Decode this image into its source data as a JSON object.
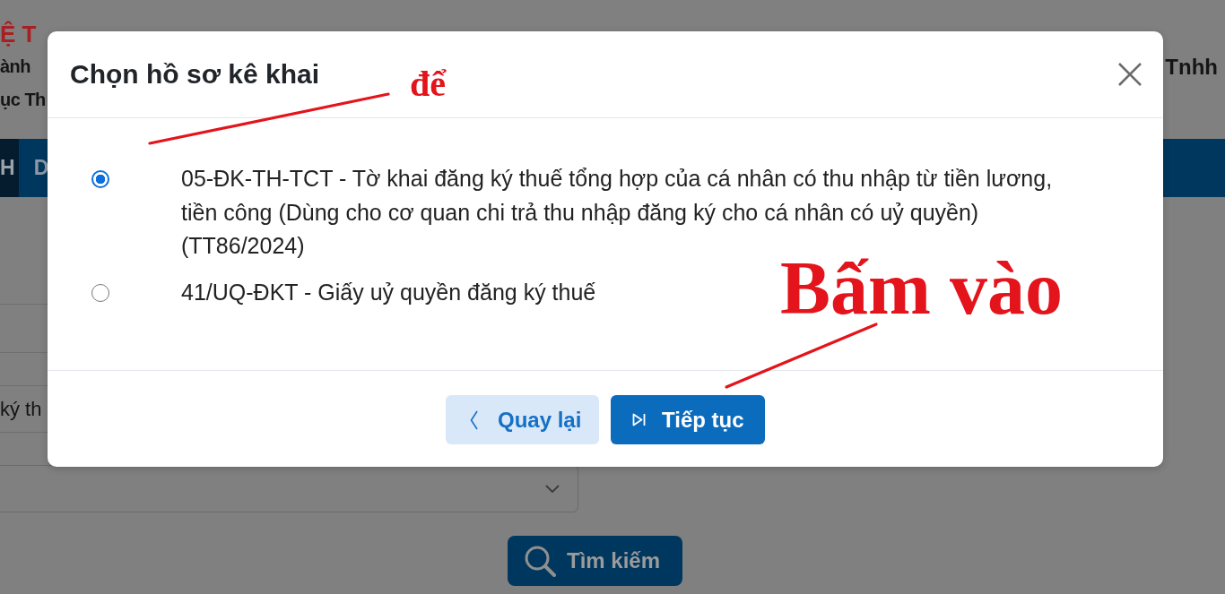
{
  "background_page": {
    "header": {
      "title": "Ệ T",
      "line_2": "ành",
      "line_3": "ục Th",
      "right_text": "Tnhh"
    },
    "nav": {
      "items": [
        {
          "label": "H",
          "selected": true
        },
        {
          "label": "D",
          "selected": false
        }
      ]
    },
    "form": {
      "field_label": "ký th",
      "search_button": "Tìm kiếm"
    }
  },
  "dialog": {
    "title": "Chọn hồ sơ kê khai",
    "options": [
      {
        "label": "05-ĐK-TH-TCT - Tờ khai đăng ký thuế tổng hợp của cá nhân có thu nhập từ tiền lương, tiền công (Dùng cho cơ quan chi trả thu nhập đăng ký cho cá nhân có uỷ quyền) (TT86/2024)",
        "selected": true
      },
      {
        "label": "41/UQ-ĐKT - Giấy uỷ quyền đăng ký thuế",
        "selected": false
      }
    ],
    "buttons": [
      {
        "kind": "secondary",
        "label": "Quay lại"
      },
      {
        "kind": "primary",
        "label": "Tiếp tục"
      }
    ]
  },
  "annotations": [
    {
      "kind": "callout",
      "text": "để"
    },
    {
      "kind": "callout",
      "text": "Bấm vào"
    }
  ]
}
